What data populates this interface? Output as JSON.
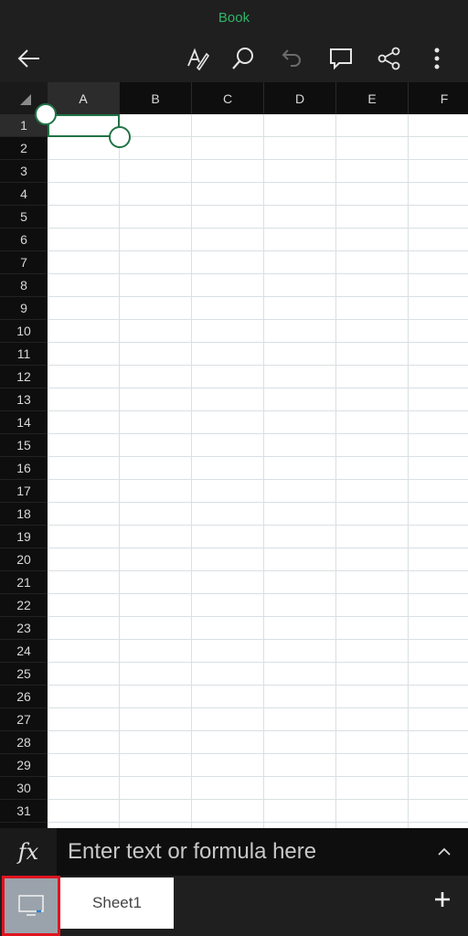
{
  "header": {
    "title": "Book"
  },
  "toolbar": {
    "icons": [
      "back-arrow-icon",
      "draw-pen-icon",
      "search-icon",
      "undo-icon",
      "comment-icon",
      "share-icon",
      "more-vertical-icon"
    ]
  },
  "grid": {
    "columns": [
      "A",
      "B",
      "C",
      "D",
      "E",
      "F"
    ],
    "rows": [
      "1",
      "2",
      "3",
      "4",
      "5",
      "6",
      "7",
      "8",
      "9",
      "10",
      "11",
      "12",
      "13",
      "14",
      "15",
      "16",
      "17",
      "18",
      "19",
      "20",
      "21",
      "22",
      "23",
      "24",
      "25",
      "26",
      "27",
      "28",
      "29",
      "30",
      "31"
    ],
    "selected_cell": {
      "column": "A",
      "row": "1"
    }
  },
  "formula_bar": {
    "fx_label": "fx",
    "placeholder": "Enter text or formula here"
  },
  "sheets": {
    "tabs": [
      "Sheet1"
    ],
    "active": "Sheet1",
    "add_label": "+"
  },
  "colors": {
    "accent": "#217346",
    "title_green": "#2fb567",
    "highlight": "#e0141f"
  }
}
